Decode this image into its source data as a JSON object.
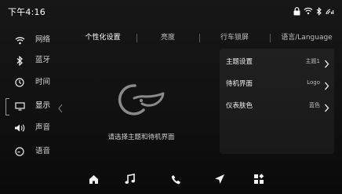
{
  "status_bar": {
    "time": "下午4:16",
    "icons": [
      "lock-icon",
      "wifi-icon",
      "bluetooth-icon",
      "signal-icon"
    ]
  },
  "sidebar": {
    "items": [
      {
        "label": "网络",
        "icon": "wifi-icon",
        "active": false
      },
      {
        "label": "蓝牙",
        "icon": "bluetooth-icon",
        "active": false
      },
      {
        "label": "时间",
        "icon": "clock-icon",
        "active": false
      },
      {
        "label": "显示",
        "icon": "display-icon",
        "active": true
      },
      {
        "label": "声音",
        "icon": "speaker-icon",
        "active": false
      },
      {
        "label": "语音",
        "icon": "voice-icon",
        "active": false
      }
    ]
  },
  "tabs": [
    {
      "label": "个性化设置",
      "active": true
    },
    {
      "label": "亮度",
      "active": false
    },
    {
      "label": "行车锁屏",
      "active": false
    },
    {
      "label": "语言/Language",
      "active": false
    }
  ],
  "main": {
    "hint": "请选择主题和待机界面"
  },
  "panel": {
    "rows": [
      {
        "label": "主题设置",
        "value": "主题1"
      },
      {
        "label": "待机界面",
        "value": "Logo"
      },
      {
        "label": "仪表肤色",
        "value": "蓝色"
      }
    ]
  },
  "dock": {
    "items": [
      "home-icon",
      "music-icon",
      "phone-icon",
      "navigation-icon",
      "apps-icon"
    ]
  }
}
